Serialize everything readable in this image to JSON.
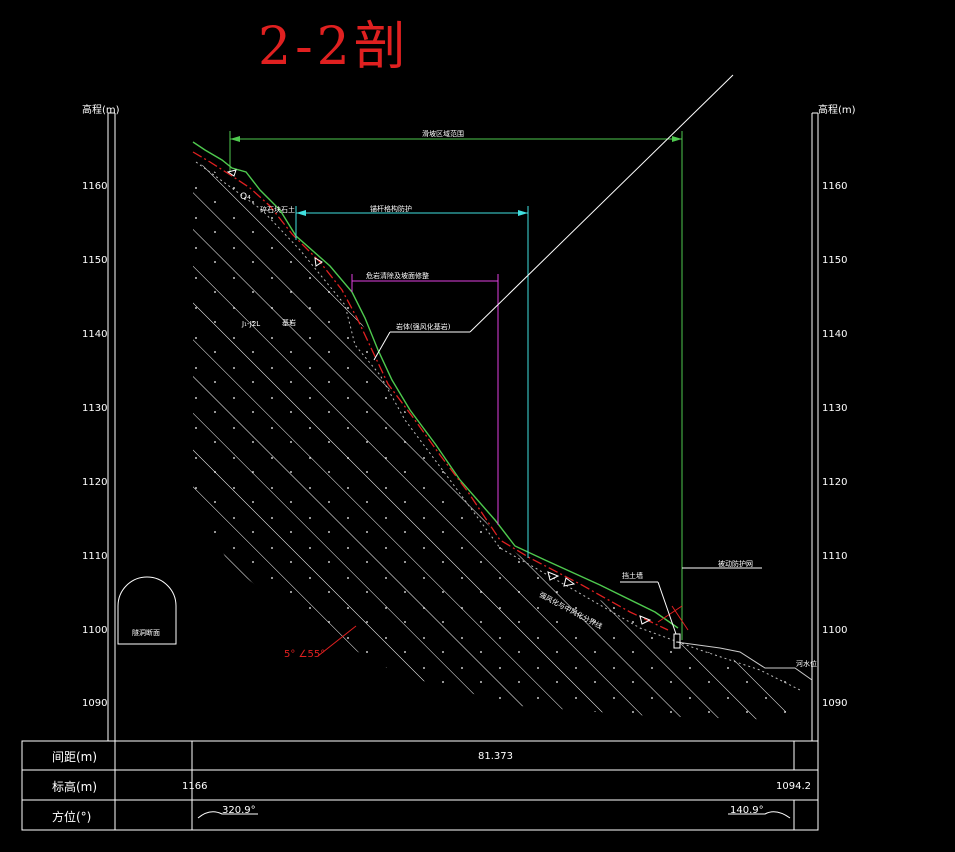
{
  "section_title": "2-2剖",
  "axis": {
    "label_left": "高程(m)",
    "label_right": "高程(m)",
    "ticks": [
      "1160",
      "1150",
      "1140",
      "1130",
      "1120",
      "1110",
      "1100",
      "1090"
    ]
  },
  "annotations": {
    "span_green": "滑坡区域范围",
    "span_cyan": "锚杆格构防护",
    "span_magenta": "危岩清除及坡面修整",
    "leader_label": "岩体(强风化基岩)",
    "q4": "Q₄",
    "top_label": "碎石块石土",
    "left_unit": "J₁-J2L",
    "left_side": "基岩",
    "lower_label": "强风化与中风化分界线",
    "wall_label": "挡土墙",
    "bottom_right_label": "被动防护网",
    "tunnel_label": "隧洞断面",
    "right_small": "河水位",
    "slope_angle": "5° ∠55°"
  },
  "table": {
    "rows": [
      {
        "label": "间距(m)",
        "values": [
          "81.373"
        ]
      },
      {
        "label": "标高(m)",
        "values": [
          "1166",
          "1094.2"
        ]
      },
      {
        "label": "方位(°)",
        "values": [
          "320.9°",
          "140.9°"
        ]
      }
    ]
  },
  "colors": {
    "ground": "#4ec94e",
    "red_line": "#e02020",
    "cyan": "#40e0e0",
    "magenta": "#e040e0",
    "white": "#ffffff"
  }
}
